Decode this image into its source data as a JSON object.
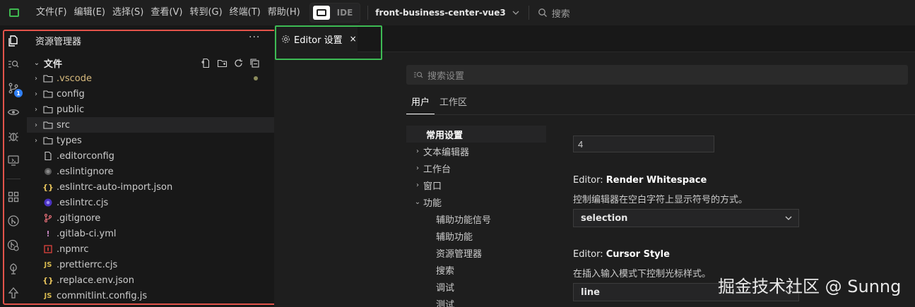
{
  "titlebar": {
    "menu": [
      "文件(F)",
      "编辑(E)",
      "选择(S)",
      "查看(V)",
      "转到(G)",
      "终端(T)",
      "帮助(H)"
    ],
    "ide_label": "IDE",
    "project": "front-business-center-vue3",
    "search_placeholder": "搜索"
  },
  "activity": {
    "items": [
      "explorer-icon",
      "search-icon",
      "source-control-icon",
      "eye-icon",
      "debug-icon",
      "remote-icon",
      "extensions-icon",
      "git-graph-icon",
      "git-icon",
      "tree-icon",
      "deploy-icon"
    ],
    "scm_badge": "1"
  },
  "explorer": {
    "title": "资源管理器",
    "more": "···",
    "section": "文件",
    "files": [
      {
        "name": ".vscode",
        "kind": "folder",
        "modified": true
      },
      {
        "name": "config",
        "kind": "folder"
      },
      {
        "name": "public",
        "kind": "folder"
      },
      {
        "name": "src",
        "kind": "folder",
        "selected": true
      },
      {
        "name": "types",
        "kind": "folder"
      },
      {
        "name": ".editorconfig",
        "kind": "file"
      },
      {
        "name": ".eslintignore",
        "kind": "eslintignore"
      },
      {
        "name": ".eslintrc-auto-import.json",
        "kind": "json"
      },
      {
        "name": ".eslintrc.cjs",
        "kind": "eslint"
      },
      {
        "name": ".gitignore",
        "kind": "git"
      },
      {
        "name": ".gitlab-ci.yml",
        "kind": "yml"
      },
      {
        "name": ".npmrc",
        "kind": "npm"
      },
      {
        "name": ".prettierrc.cjs",
        "kind": "js"
      },
      {
        "name": ".replace.env.json",
        "kind": "json"
      },
      {
        "name": "commitlint.config.js",
        "kind": "js"
      }
    ]
  },
  "editor": {
    "tab_label": "Editor 设置",
    "tab_close": "×",
    "search_placeholder": "搜索设置",
    "scope_tabs": [
      "用户",
      "工作区"
    ],
    "toc": [
      {
        "label": "常用设置",
        "level": 0,
        "arrow": "",
        "active": true
      },
      {
        "label": "文本编辑器",
        "level": 0,
        "arrow": "›"
      },
      {
        "label": "工作台",
        "level": 0,
        "arrow": "›"
      },
      {
        "label": "窗口",
        "level": 0,
        "arrow": "›"
      },
      {
        "label": "功能",
        "level": 0,
        "arrow": "⌄"
      },
      {
        "label": "辅助功能信号",
        "level": 1
      },
      {
        "label": "辅助功能",
        "level": 1
      },
      {
        "label": "资源管理器",
        "level": 1
      },
      {
        "label": "搜索",
        "level": 1
      },
      {
        "label": "调试",
        "level": 1
      },
      {
        "label": "测试",
        "level": 1
      }
    ],
    "tab_size_value": "4",
    "render_whitespace": {
      "prefix": "Editor: ",
      "name": "Render Whitespace",
      "desc": "控制编辑器在空白字符上显示符号的方式。",
      "value": "selection"
    },
    "cursor_style": {
      "prefix": "Editor: ",
      "name": "Cursor Style",
      "desc": "在插入输入模式下控制光标样式。",
      "value": "line"
    }
  },
  "watermark": "掘金技术社区 @ Sunng"
}
